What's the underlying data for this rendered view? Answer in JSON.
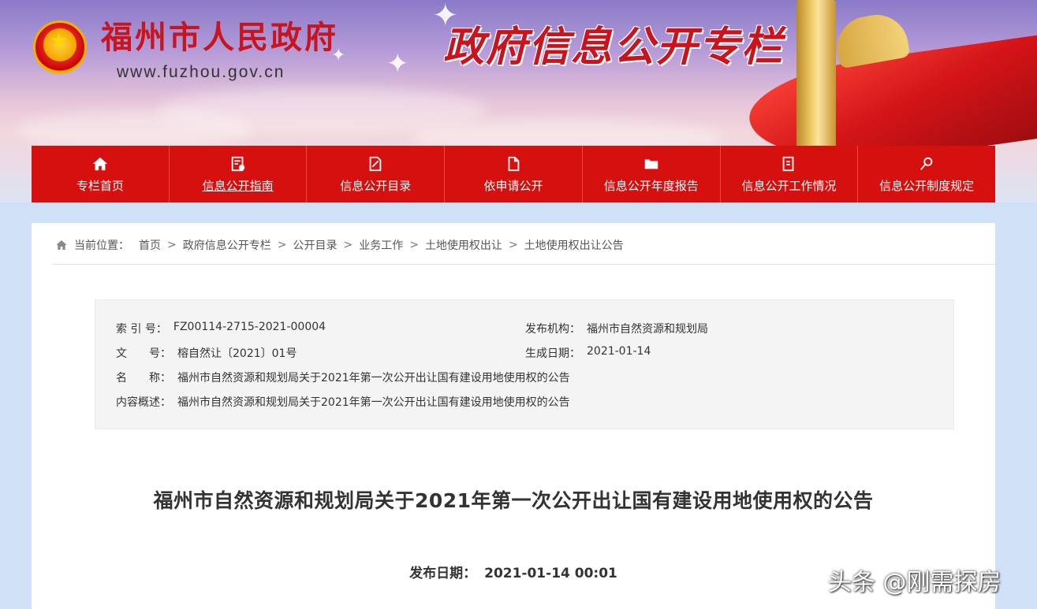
{
  "header": {
    "site_title": "福州市人民政府",
    "site_url": "www.fuzhou.gov.cn",
    "column_title": "政府信息公开专栏"
  },
  "nav": {
    "items": [
      {
        "label": "专栏首页",
        "icon": "home-icon"
      },
      {
        "label": "信息公开指南",
        "icon": "guide-icon"
      },
      {
        "label": "信息公开目录",
        "icon": "catalog-icon"
      },
      {
        "label": "依申请公开",
        "icon": "document-icon"
      },
      {
        "label": "信息公开年度报告",
        "icon": "report-icon"
      },
      {
        "label": "信息公开工作情况",
        "icon": "work-icon"
      },
      {
        "label": "信息公开制度规定",
        "icon": "rules-icon"
      }
    ],
    "bg_color": "#d5100f"
  },
  "breadcrumb": {
    "label": "当前位置：",
    "items": [
      "首页",
      "政府信息公开专栏",
      "公开目录",
      "业务工作",
      "土地使用权出让",
      "土地使用权出让公告"
    ],
    "separator": ">"
  },
  "meta": {
    "index_key": "索 引 号：",
    "index_value": "FZ00114-2715-2021-00004",
    "publisher_key": "发布机构：",
    "publisher_value": "福州市自然资源和规划局",
    "docno_key": "文　　号：",
    "docno_value": "榕自然让〔2021〕01号",
    "created_key": "生成日期：",
    "created_value": "2021-01-14",
    "name_key": "名　　称：",
    "name_value": "福州市自然资源和规划局关于2021年第一次公开出让国有建设用地使用权的公告",
    "summary_key": "内容概述：",
    "summary_value": "福州市自然资源和规划局关于2021年第一次公开出让国有建设用地使用权的公告"
  },
  "document": {
    "title": "福州市自然资源和规划局关于2021年第一次公开出让国有建设用地使用权的公告",
    "date_label": "发布日期：",
    "date_value": "2021-01-14 00:01"
  },
  "watermark": "头条 @刚需探房"
}
